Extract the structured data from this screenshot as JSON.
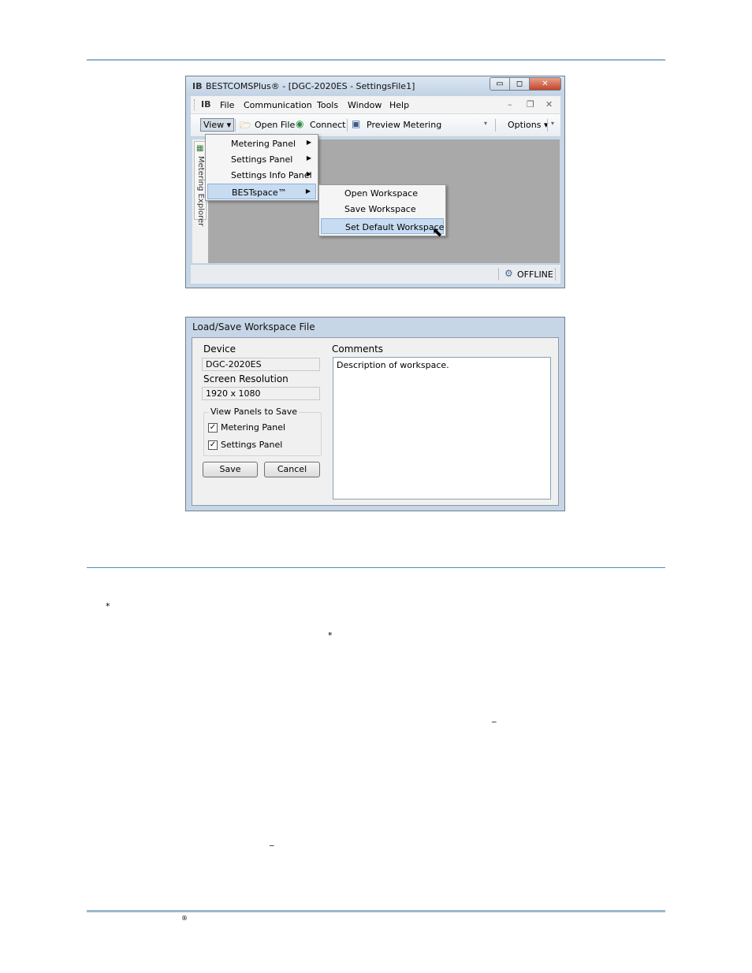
{
  "page": {
    "asterisk_1": "*",
    "asterisk_2": "*",
    "underline_1": "_",
    "underline_2": "_",
    "registered": "®"
  },
  "main_window": {
    "title": "BESTCOMSPlus® - [DGC-2020ES - SettingsFile1]",
    "app_icon_glyph": "IB",
    "caption_buttons": {
      "minimize": "▭",
      "maximize": "◻",
      "close": "✕"
    },
    "menubar": {
      "items": [
        "File",
        "Communication",
        "Tools",
        "Window",
        "Help"
      ],
      "mdi": {
        "minimize": "–",
        "restore": "❐",
        "close": "✕"
      }
    },
    "toolbar": {
      "view": "View ▾",
      "open_file": "Open File",
      "connect": "Connect",
      "preview_metering": "Preview Metering",
      "options": "Options ▾",
      "dropdown": "▾"
    },
    "side_tab_label": "Metering Explorer",
    "status": "OFFLINE",
    "view_menu": {
      "items": [
        {
          "label": "Metering Panel",
          "arrow": "▶"
        },
        {
          "label": "Settings Panel",
          "arrow": "▶"
        },
        {
          "label": "Settings Info Panel",
          "arrow": "▶"
        },
        {
          "label": "BESTspace™",
          "arrow": "▶"
        }
      ]
    },
    "bestspace_submenu": {
      "items": [
        "Open Workspace",
        "Save Workspace",
        "Set Default Workspace"
      ]
    }
  },
  "dialog": {
    "title": "Load/Save Workspace File",
    "device_label": "Device",
    "device_value": "DGC-2020ES",
    "resolution_label": "Screen Resolution",
    "resolution_value": "1920 x 1080",
    "group_title": "View Panels to Save",
    "metering_panel": {
      "label": "Metering Panel",
      "checked": "✓"
    },
    "settings_panel": {
      "label": "Settings Panel",
      "checked": "✓"
    },
    "save_button": "Save",
    "cancel_button": "Cancel",
    "comments_label": "Comments",
    "comments_value": "Description of workspace."
  }
}
